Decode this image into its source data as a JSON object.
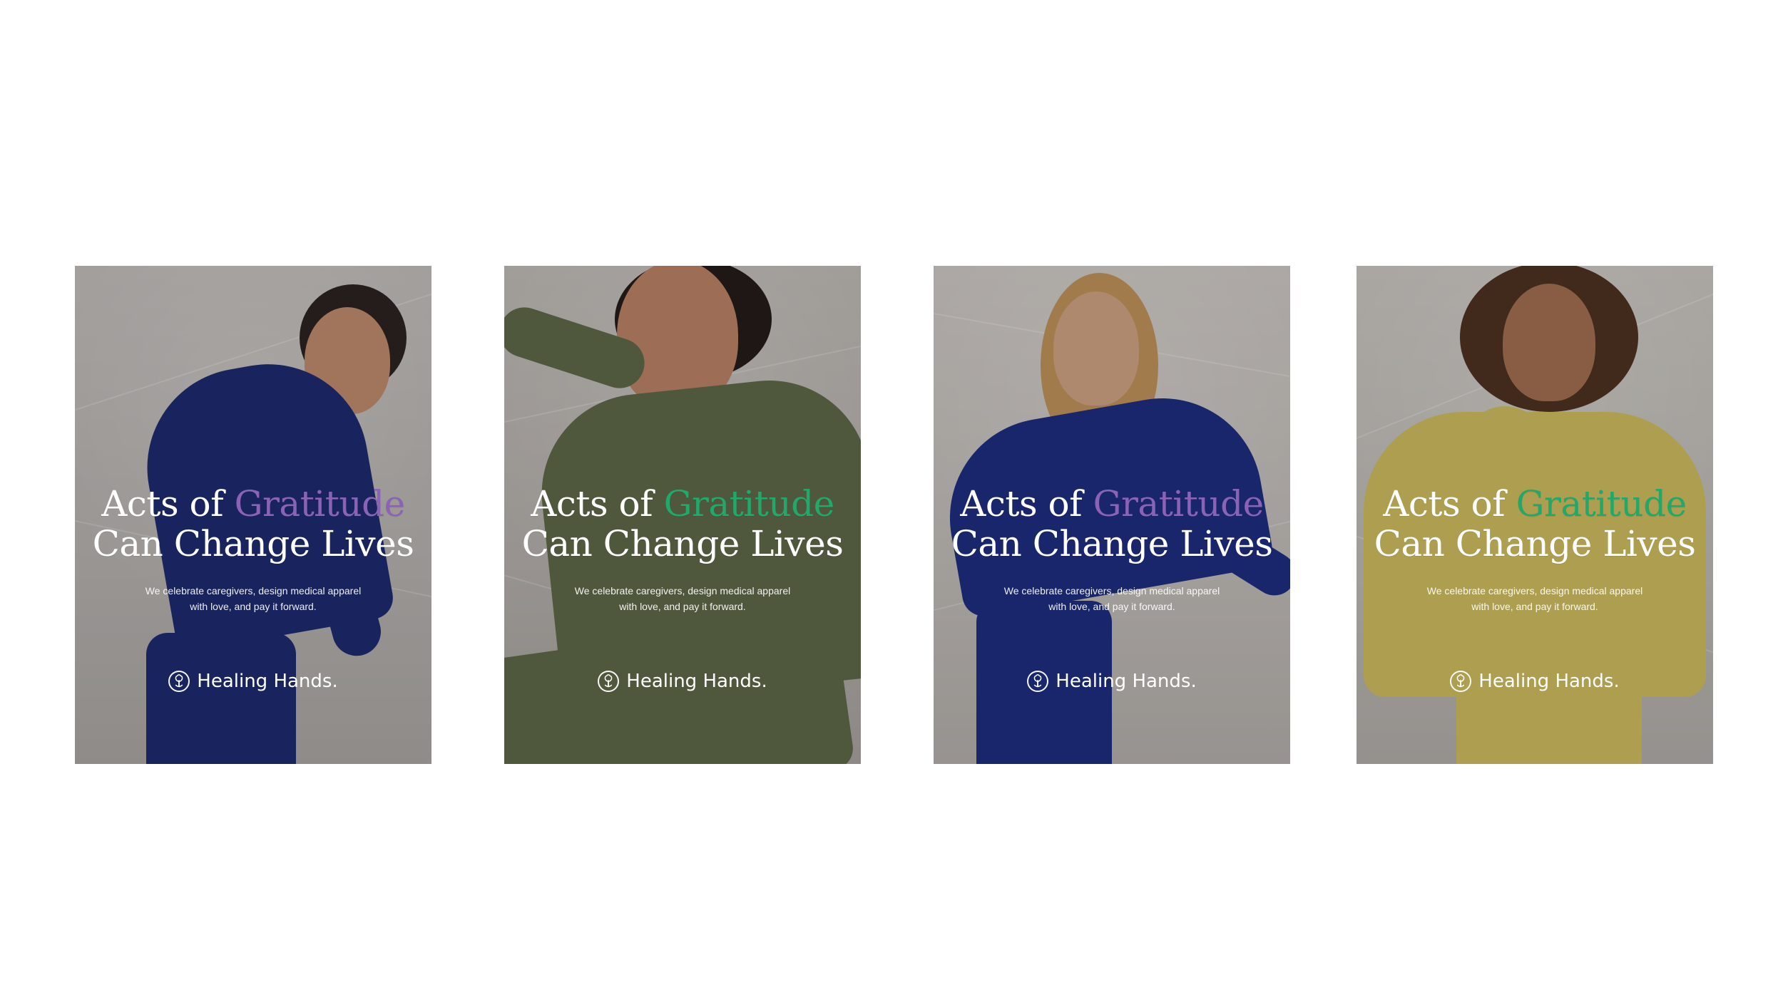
{
  "posters": [
    {
      "headline_line1_prefix": "Acts of ",
      "headline_line1_accent": "Gratitude",
      "headline_line2": "Can Change Lives",
      "subcopy_line1": "We celebrate caregivers, design medical apparel",
      "subcopy_line2": "with love, and pay it forward.",
      "brand_name": "Healing Hands.",
      "accent_color": "#8A63B6",
      "bg_color": "#B9B5B2",
      "garment_color": "#1D2A6B",
      "skin_color": "#B88569",
      "hair_color": "#2A2220"
    },
    {
      "headline_line1_prefix": "Acts of ",
      "headline_line1_accent": "Gratitude",
      "headline_line2": "Can Change Lives",
      "subcopy_line1": "We celebrate caregivers, design medical apparel",
      "subcopy_line2": "with love, and pay it forward.",
      "brand_name": "Healing Hands.",
      "accent_color": "#22A86B",
      "bg_color": "#B7B2AE",
      "garment_color": "#5A6446",
      "skin_color": "#B37E61",
      "hair_color": "#231B18"
    },
    {
      "headline_line1_prefix": "Acts of ",
      "headline_line1_accent": "Gratitude",
      "headline_line2": "Can Change Lives",
      "subcopy_line1": "We celebrate caregivers, design medical apparel",
      "subcopy_line2": "with love, and pay it forward.",
      "brand_name": "Healing Hands.",
      "accent_color": "#8A63B6",
      "bg_color": "#C4BFBB",
      "garment_color": "#1E2C7A",
      "skin_color": "#C79C7E",
      "hair_color": "#B98D58"
    },
    {
      "headline_line1_prefix": "Acts of ",
      "headline_line1_accent": "Gratitude",
      "headline_line2": "Can Change Lives",
      "subcopy_line1": "We celebrate caregivers, design medical apparel",
      "subcopy_line2": "with love, and pay it forward.",
      "brand_name": "Healing Hands.",
      "accent_color": "#22A86B",
      "bg_color": "#C1BDB8",
      "garment_color": "#C7B45A",
      "skin_color": "#9B6A4E",
      "hair_color": "#4A2F20"
    }
  ]
}
